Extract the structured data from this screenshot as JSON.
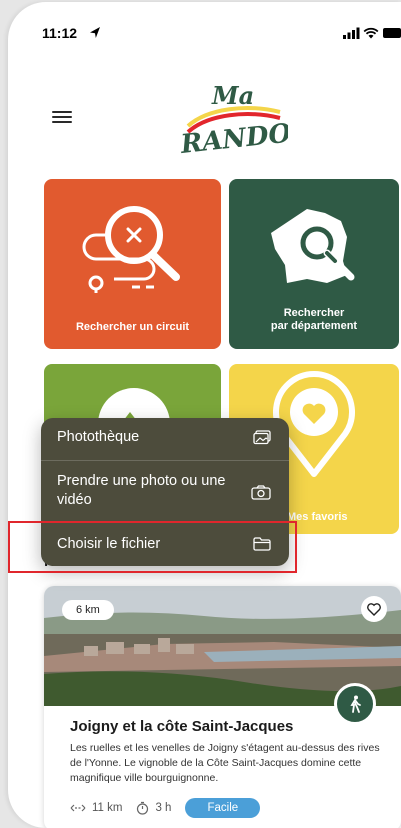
{
  "status_bar": {
    "time": "11:12"
  },
  "tiles": [
    {
      "label": "Rechercher un circuit",
      "color": "#e15a2f",
      "icon": "magnifier-trail-icon"
    },
    {
      "label_line1": "Rechercher",
      "label_line2": "par département",
      "color": "#2f5a45",
      "icon": "france-map-search-icon"
    },
    {
      "label": "",
      "color": "#7aa53a",
      "icon": "mountain-icon"
    },
    {
      "label": "Mes favoris",
      "color": "#f4d54a",
      "icon": "heart-pin-icon"
    }
  ],
  "section": {
    "title": "Nos recommandations"
  },
  "card": {
    "distance_badge": "6 km",
    "title": "Joigny et la côte Saint-Jacques",
    "description": "Les ruelles et les venelles de Joigny s'étagent au-dessus des rives de l'Yonne. Le vignoble de la Côte Saint-Jacques domine cette magnifique ville bourguignonne.",
    "meta": {
      "distance": "11 km",
      "duration": "3 h",
      "difficulty": "Facile"
    }
  },
  "popup_menu": {
    "items": [
      {
        "label": "Photothèque",
        "icon": "photo-library-icon"
      },
      {
        "label": "Prendre une photo ou une vidéo",
        "icon": "camera-icon"
      },
      {
        "label": "Choisir le fichier",
        "icon": "folder-icon"
      }
    ]
  },
  "logo": {
    "text_top": "Ma",
    "text_main": "RANDO"
  },
  "colors": {
    "accent_green": "#2f5a45",
    "accent_orange": "#e15a2f",
    "accent_yellow": "#f4d54a",
    "accent_lime": "#7aa53a",
    "difficulty_blue": "#4b9fd8",
    "highlight_red": "#e0262c"
  }
}
